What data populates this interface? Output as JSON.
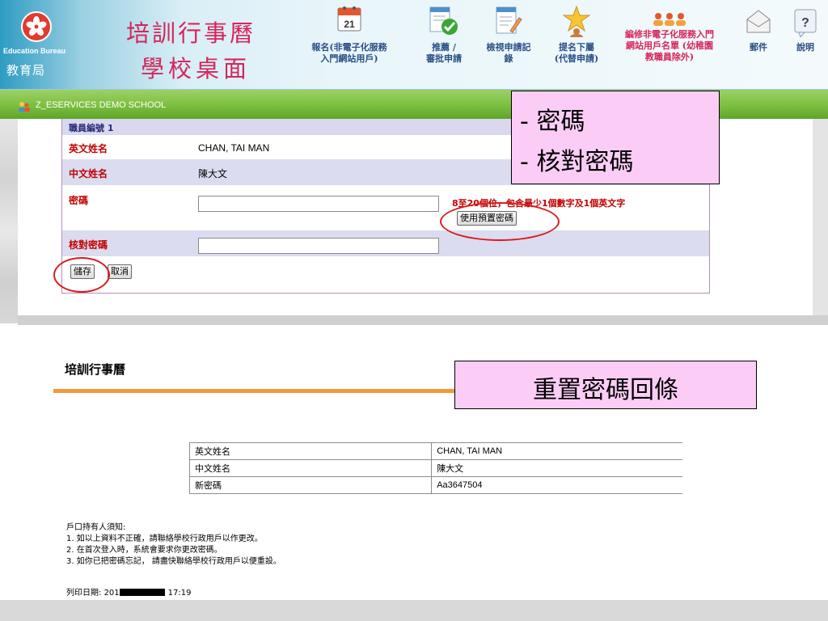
{
  "header": {
    "bureau_en": "Education Bureau",
    "bureau_zh": "教育局",
    "title_line1": "培訓行事曆",
    "title_line2": "學校桌面",
    "nav": [
      {
        "label": "報名(非電子化服務\n入門網站用戶)",
        "icon": "calendar-icon",
        "calendar_day": "21"
      },
      {
        "label": "推薦 /\n審批申請",
        "icon": "approve-document-icon"
      },
      {
        "label": "檢視申請記\n錄",
        "icon": "edit-document-icon"
      },
      {
        "label": "提名下屬\n(代替申請)",
        "icon": "star-person-icon"
      },
      {
        "label": "編修非電子化服務入門\n網站用戶名單 (幼稚園\n教職員除外)",
        "icon": "user-group-icon"
      },
      {
        "label": "郵件",
        "icon": "envelope-icon"
      },
      {
        "label": "說明",
        "icon": "help-icon",
        "glyph": "?"
      }
    ]
  },
  "school_bar": {
    "school_name": "Z_ESERVICES DEMO SCHOOL"
  },
  "form": {
    "section_title": "職員編號 1",
    "english_name_label": "英文姓名",
    "english_name_value": "CHAN, TAI MAN",
    "chinese_name_label": "中文姓名",
    "chinese_name_value": "陳大文",
    "password_label": "密碼",
    "password_value": "",
    "password_hint": "8至20個位，包含最少1個數字及1個英文字",
    "use_default_password_button": "使用預置密碼",
    "confirm_password_label": "核對密碼",
    "confirm_password_value": "",
    "save_button": "儲存",
    "cancel_button": "取消"
  },
  "callouts": {
    "password_fields_line1": "- 密碼",
    "password_fields_line2": "- 核對密碼",
    "reset_slip": "重置密碼回條"
  },
  "slip": {
    "title": "培訓行事曆",
    "rows": [
      {
        "label": "英文姓名",
        "value": "CHAN, TAI MAN"
      },
      {
        "label": "中文姓名",
        "value": "陳大文"
      },
      {
        "label": "新密碼",
        "value": "Aa3647504"
      }
    ],
    "notice_heading": "戶口持有人須知:",
    "notices": [
      "1. 如以上資料不正確，請聯絡學校行政用戶以作更改。",
      "2. 在首次登入時，系統會要求你更改密碼。",
      "3. 如你已把密碼忘記， 請盡快聯絡學校行政用戶以便重設。"
    ],
    "print_date_label": "列印日期:",
    "print_date_prefix": "201",
    "print_time": "17:19"
  },
  "colors": {
    "highlight_ellipse": "#d91c1c",
    "callout_fill": "#fbcdf6",
    "field_label": "#c20000",
    "school_bar": "#7cbf3f",
    "slip_rule": "#f29a3b"
  }
}
